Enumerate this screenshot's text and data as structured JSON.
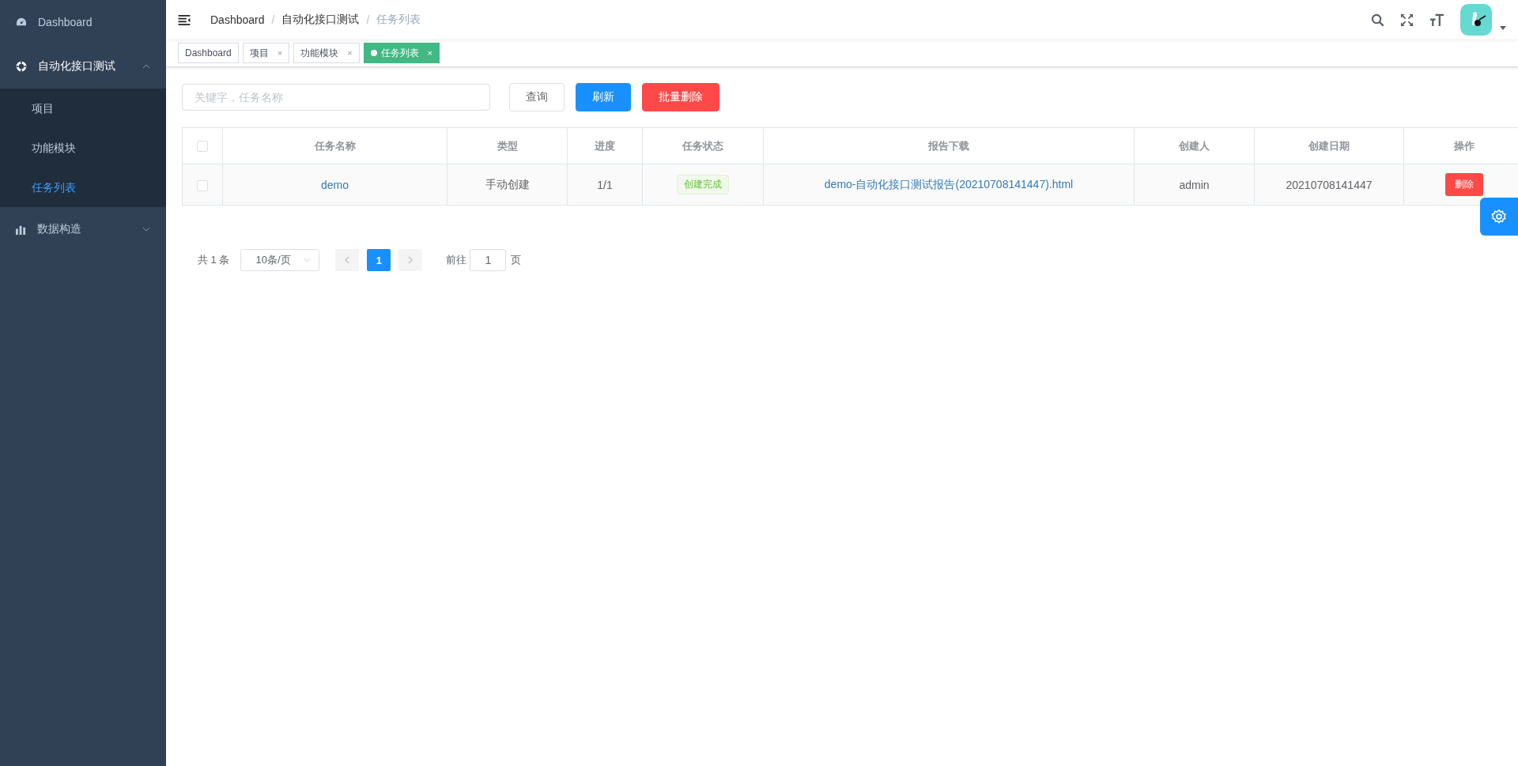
{
  "sidebar": {
    "items": [
      {
        "label": "Dashboard"
      },
      {
        "label": "自动化接口测试",
        "expanded": true,
        "children": [
          {
            "label": "项目",
            "selected": false
          },
          {
            "label": "功能模块",
            "selected": false
          },
          {
            "label": "任务列表",
            "selected": true
          }
        ]
      },
      {
        "label": "数据构造",
        "expanded": false
      }
    ]
  },
  "breadcrumb": [
    "Dashboard",
    "自动化接口测试",
    "任务列表"
  ],
  "breadcrumb_separator": "/",
  "tags": [
    {
      "label": "Dashboard",
      "selected": false,
      "closable": false
    },
    {
      "label": "项目",
      "selected": false,
      "closable": true
    },
    {
      "label": "功能模块",
      "selected": false,
      "closable": true
    },
    {
      "label": "任务列表",
      "selected": true,
      "closable": true
    }
  ],
  "close_glyph": "×",
  "toolbar": {
    "search": {
      "placeholder": "关键字，任务名称"
    },
    "buttons": [
      {
        "label": "查询",
        "kind": "default"
      },
      {
        "label": "刷新",
        "kind": "primary"
      },
      {
        "label": "批量删除",
        "kind": "danger"
      }
    ]
  },
  "table": {
    "all_checked": false,
    "columns": [
      "任务名称",
      "类型",
      "进度",
      "任务状态",
      "报告下载",
      "创建人",
      "创建日期",
      "操作"
    ],
    "rows": [
      {
        "checked": false,
        "name": "demo",
        "type": "手动创建",
        "progress": "1/1",
        "status": "创建完成",
        "report": "demo-自动化接口测试报告(20210708141447).html",
        "creator": "admin",
        "date": "20210708141447",
        "action": "删除"
      }
    ]
  },
  "pagination": {
    "total": "共 1 条",
    "page_size": "10条/页",
    "pages": [
      {
        "label": "1",
        "selected": true
      }
    ],
    "goto_label": "前往",
    "goto_value": "1",
    "goto_suffix": "页"
  }
}
